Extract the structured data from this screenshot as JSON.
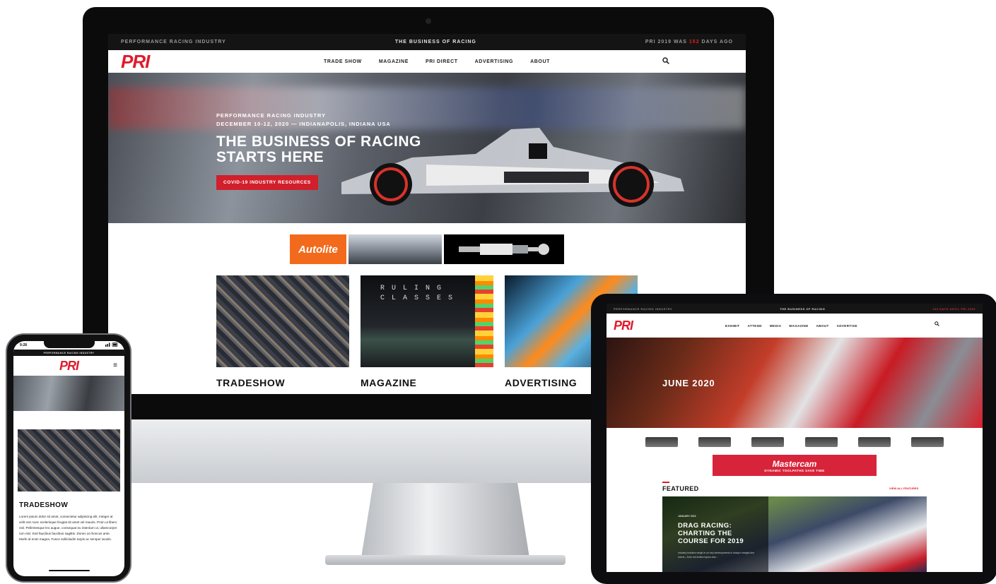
{
  "desktop": {
    "topbar": {
      "left": "PERFORMANCE RACING INDUSTRY",
      "center": "THE BUSINESS OF RACING",
      "right_prefix": "PRI 2019 WAS",
      "right_days": "152",
      "right_suffix": "DAYS AGO"
    },
    "logo": "PRI",
    "nav": [
      "TRADE SHOW",
      "MAGAZINE",
      "PRI DIRECT",
      "ADVERTISING",
      "ABOUT"
    ],
    "hero": {
      "kicker": "PERFORMANCE RACING INDUSTRY",
      "dates": "DECEMBER 10-12, 2020 — INDIANAPOLIS, INDIANA USA",
      "title": "THE BUSINESS OF RACING STARTS HERE",
      "button": "COVID-19 INDUSTRY RESOURCES"
    },
    "ads": {
      "autolite": "Autolite"
    },
    "tiles": [
      {
        "title": "TRADESHOW"
      },
      {
        "title": "MAGAZINE",
        "image_text": "RULING CLASSES"
      },
      {
        "title": "ADVERTISING"
      }
    ]
  },
  "tablet": {
    "topbar": {
      "left": "PERFORMANCE RACING INDUSTRY",
      "center": "THE BUSINESS OF RACING",
      "right": "163 DAYS UNTIL PRI 2020"
    },
    "logo": "PRI",
    "nav": [
      "EXHIBIT",
      "ATTEND",
      "MEDIA",
      "MAGAZINE",
      "ABOUT",
      "ADVERTISE"
    ],
    "hero_title": "JUNE 2020",
    "mastercam": {
      "name": "Mastercam",
      "tagline": "DYNAMIC TOOLPATHS SAVE TIME"
    },
    "featured": {
      "label": "FEATURED",
      "view_all": "VIEW ALL FEATURES"
    },
    "card": {
      "date": "JANUARY 2019",
      "title": "DRAG RACING: CHARTING THE COURSE FOR 2019",
      "excerpt": "Industry insiders weigh in on key developments in today's straight-line scene—from hot-button topics and..."
    }
  },
  "phone": {
    "time": "9:28",
    "topbar": "PERFORMANCE RACING INDUSTRY",
    "logo": "PRI",
    "menu_icon": "≡",
    "tile_title": "TRADESHOW",
    "body": "Lorem ipsum dolor sit amet, consectetur adipiscing elit. Integer at velit non nunc scelerisque feugiat sit amet vel mauris. Proin ut libero nisl. Pellentesque leo augue, consequat eu interdum ut, ullamcorper non nisl. Sed faucibus faucibus sagittis. Donec at rhoncus ante. Morbi id enim magna. Fusce sollicitudin turpis ac semper iaculis."
  }
}
